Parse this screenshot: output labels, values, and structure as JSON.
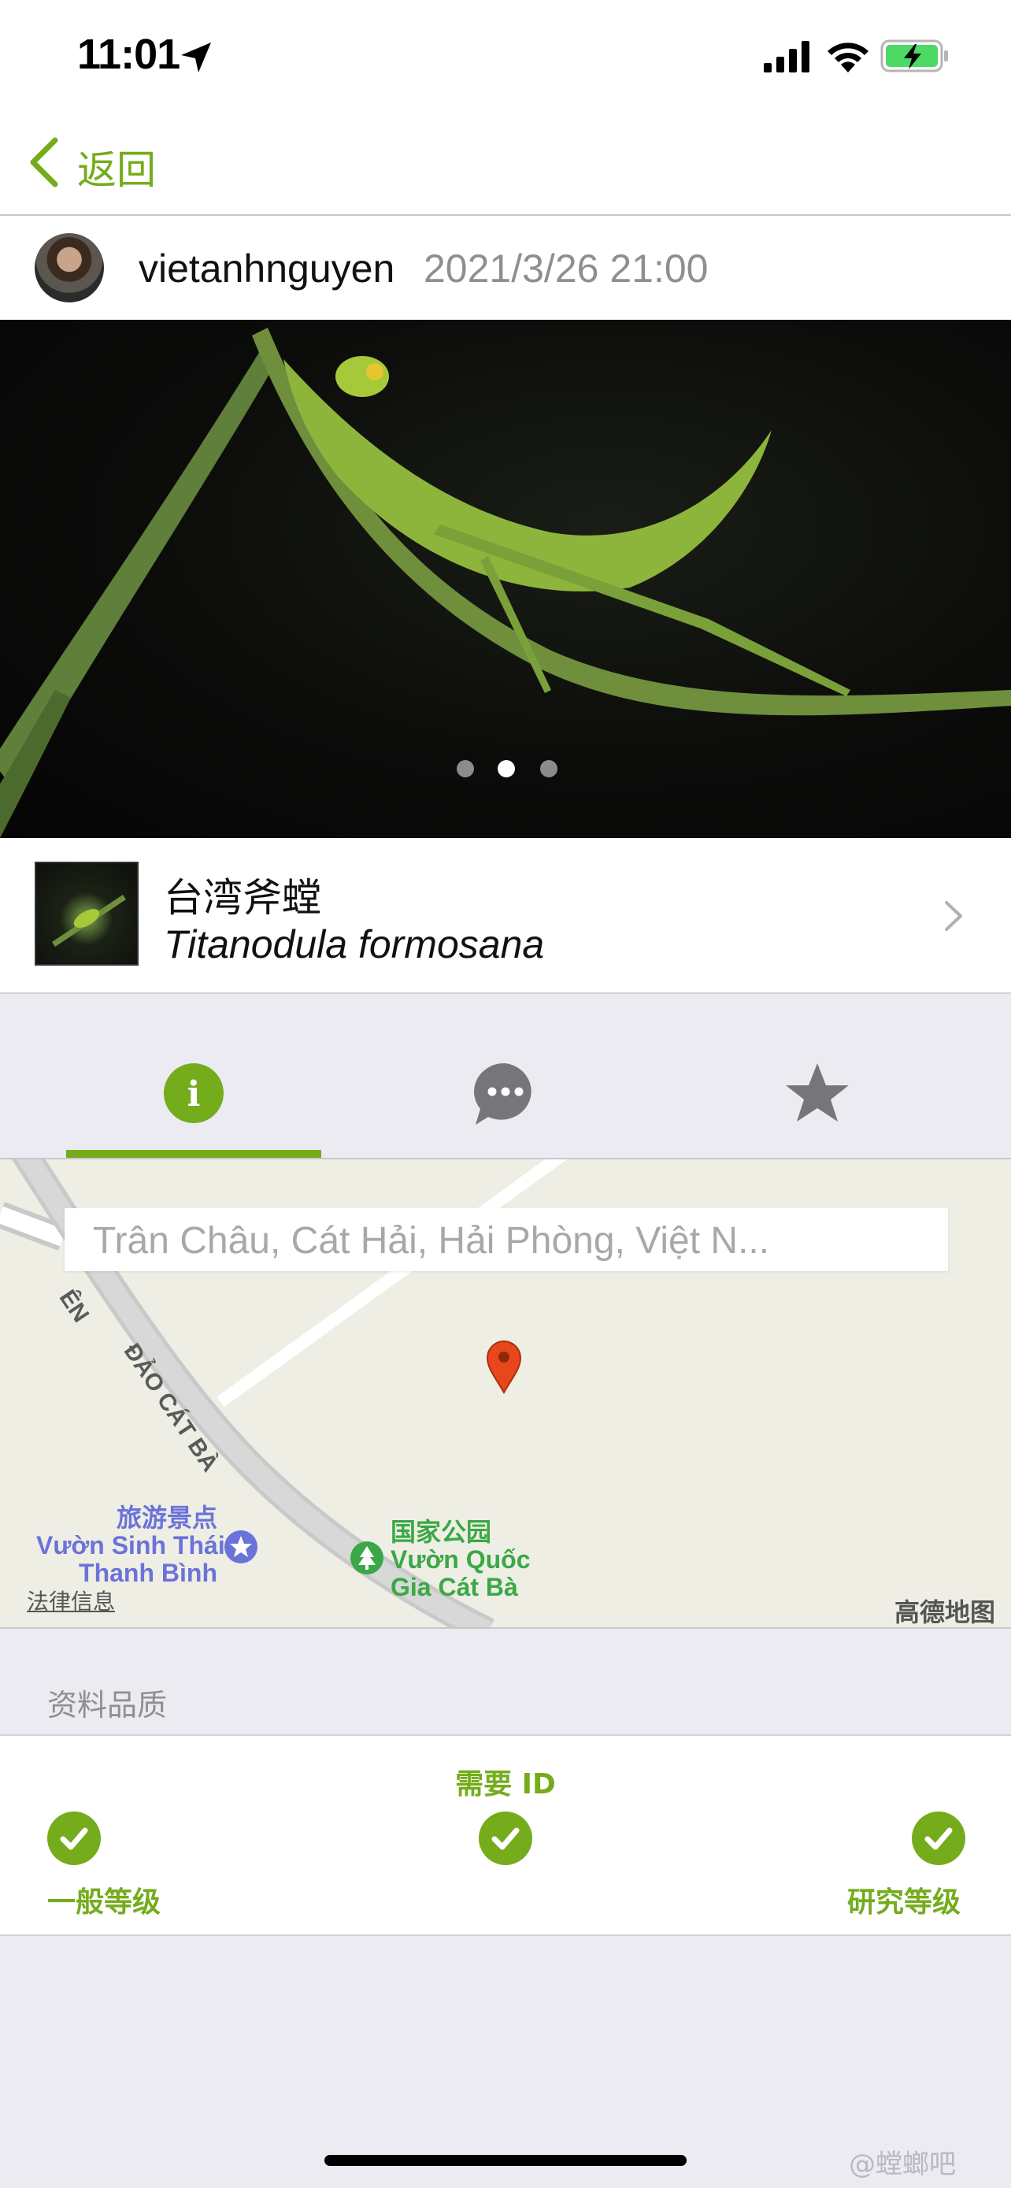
{
  "status_bar": {
    "time": "11:01"
  },
  "nav": {
    "back_label": "返回"
  },
  "observation": {
    "username": "vietanhnguyen",
    "timestamp": "2021/3/26 21:00",
    "photo_count": 3,
    "current_photo_index": 2
  },
  "taxon": {
    "common_name": "台湾斧螳",
    "scientific_name": "Titanodula formosana"
  },
  "tabs": [
    {
      "name": "info",
      "icon": "info-icon",
      "active": true
    },
    {
      "name": "comments",
      "icon": "chat-bubble-icon",
      "active": false
    },
    {
      "name": "favorites",
      "icon": "star-icon",
      "active": false
    }
  ],
  "map": {
    "location_text": "Trân Châu, Cát Hải, Hải Phòng, Việt N...",
    "road_label": "ĐẢO CÁT BÀ",
    "road_label_prefix": "ÊN",
    "poi_tourist": {
      "category": "旅游景点",
      "line1": "Vườn Sinh Thái",
      "line2": "Thanh Bình"
    },
    "poi_park": {
      "category": "国家公园",
      "line1": "Vườn Quốc",
      "line2": "Gia Cát Bà"
    },
    "legal_link": "法律信息",
    "provider": "高德地图"
  },
  "quality": {
    "section_title": "资料品质",
    "current_grade": "需要 ID",
    "left_grade": "一般等级",
    "right_grade": "研究等级"
  },
  "watermark": "@螳螂吧",
  "colors": {
    "accent": "#74ac1c",
    "secondary_text": "#8e8e93",
    "background": "#ecebf2",
    "map_pin": "#e8471b"
  }
}
